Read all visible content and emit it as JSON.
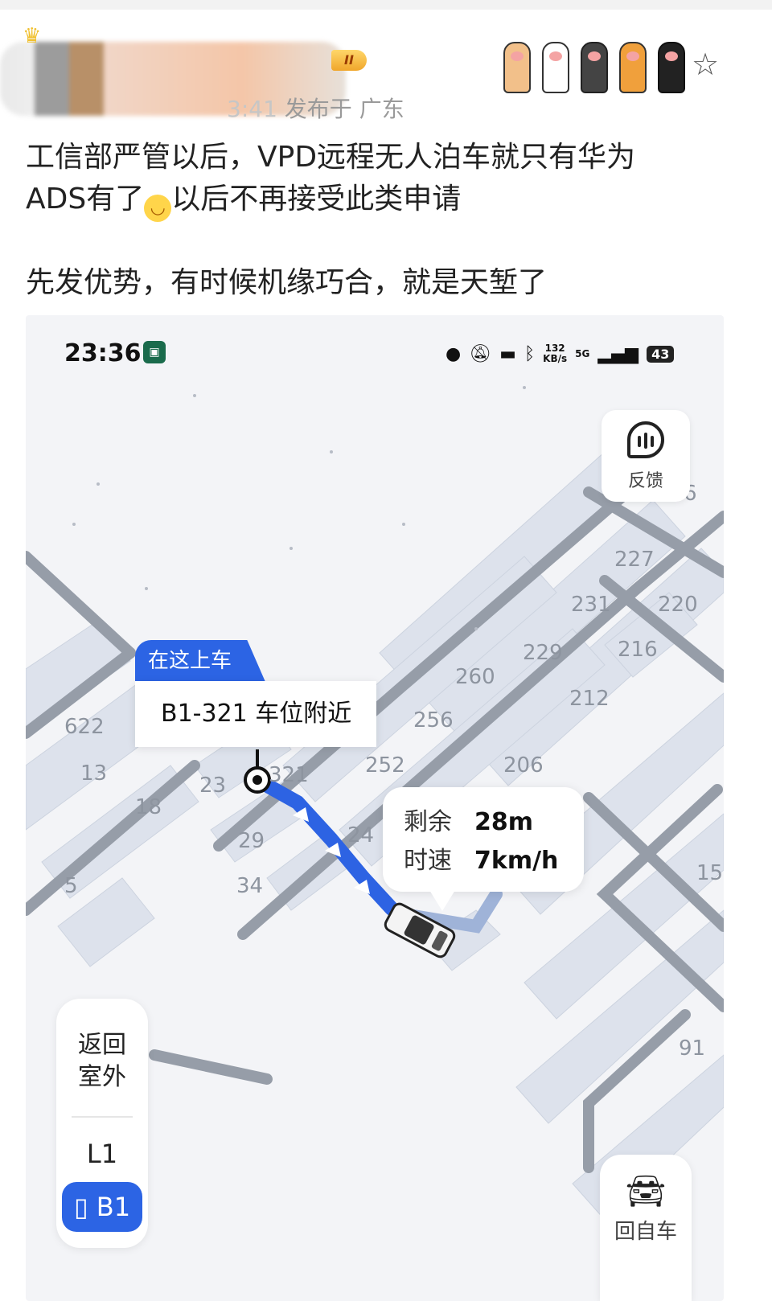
{
  "post": {
    "vip_badge": "II",
    "time_fragment": "3:41",
    "location": "发布于 广东",
    "body_line1": "工信部严管以后，VPD远程无人泊车就只有华为",
    "body_line2_a": "ADS有了",
    "body_line2_b": "以后不再接受此类申请",
    "body_line3": "先发优势，有时候机缘巧合，就是天堑了"
  },
  "phone": {
    "status_time": "23:36",
    "net_speed_value": "132",
    "net_speed_unit": "KB/s",
    "network": "5G",
    "battery": "43"
  },
  "map": {
    "feedback_label": "反馈",
    "pickup_tag": "在这上车",
    "pickup_location": "B1-321 车位附近",
    "remaining_label": "剩余",
    "remaining_value": "28m",
    "speed_label": "时速",
    "speed_value": "7km/h",
    "back_outdoor": "返回室外",
    "floor_l1": "L1",
    "floor_b1": "B1",
    "back_to_car": "回自车",
    "spot_labels": [
      "227",
      "231",
      "220",
      "229",
      "216",
      "260",
      "212",
      "256",
      "252",
      "206",
      "622",
      "13",
      "23",
      "321",
      "18",
      "29",
      "24",
      "5",
      "34",
      "15",
      "91",
      "6"
    ]
  },
  "colors": {
    "accent": "#2c64e4",
    "route": "#2d63e3",
    "map_bg": "#f3f4f7",
    "road": "#969da8"
  }
}
